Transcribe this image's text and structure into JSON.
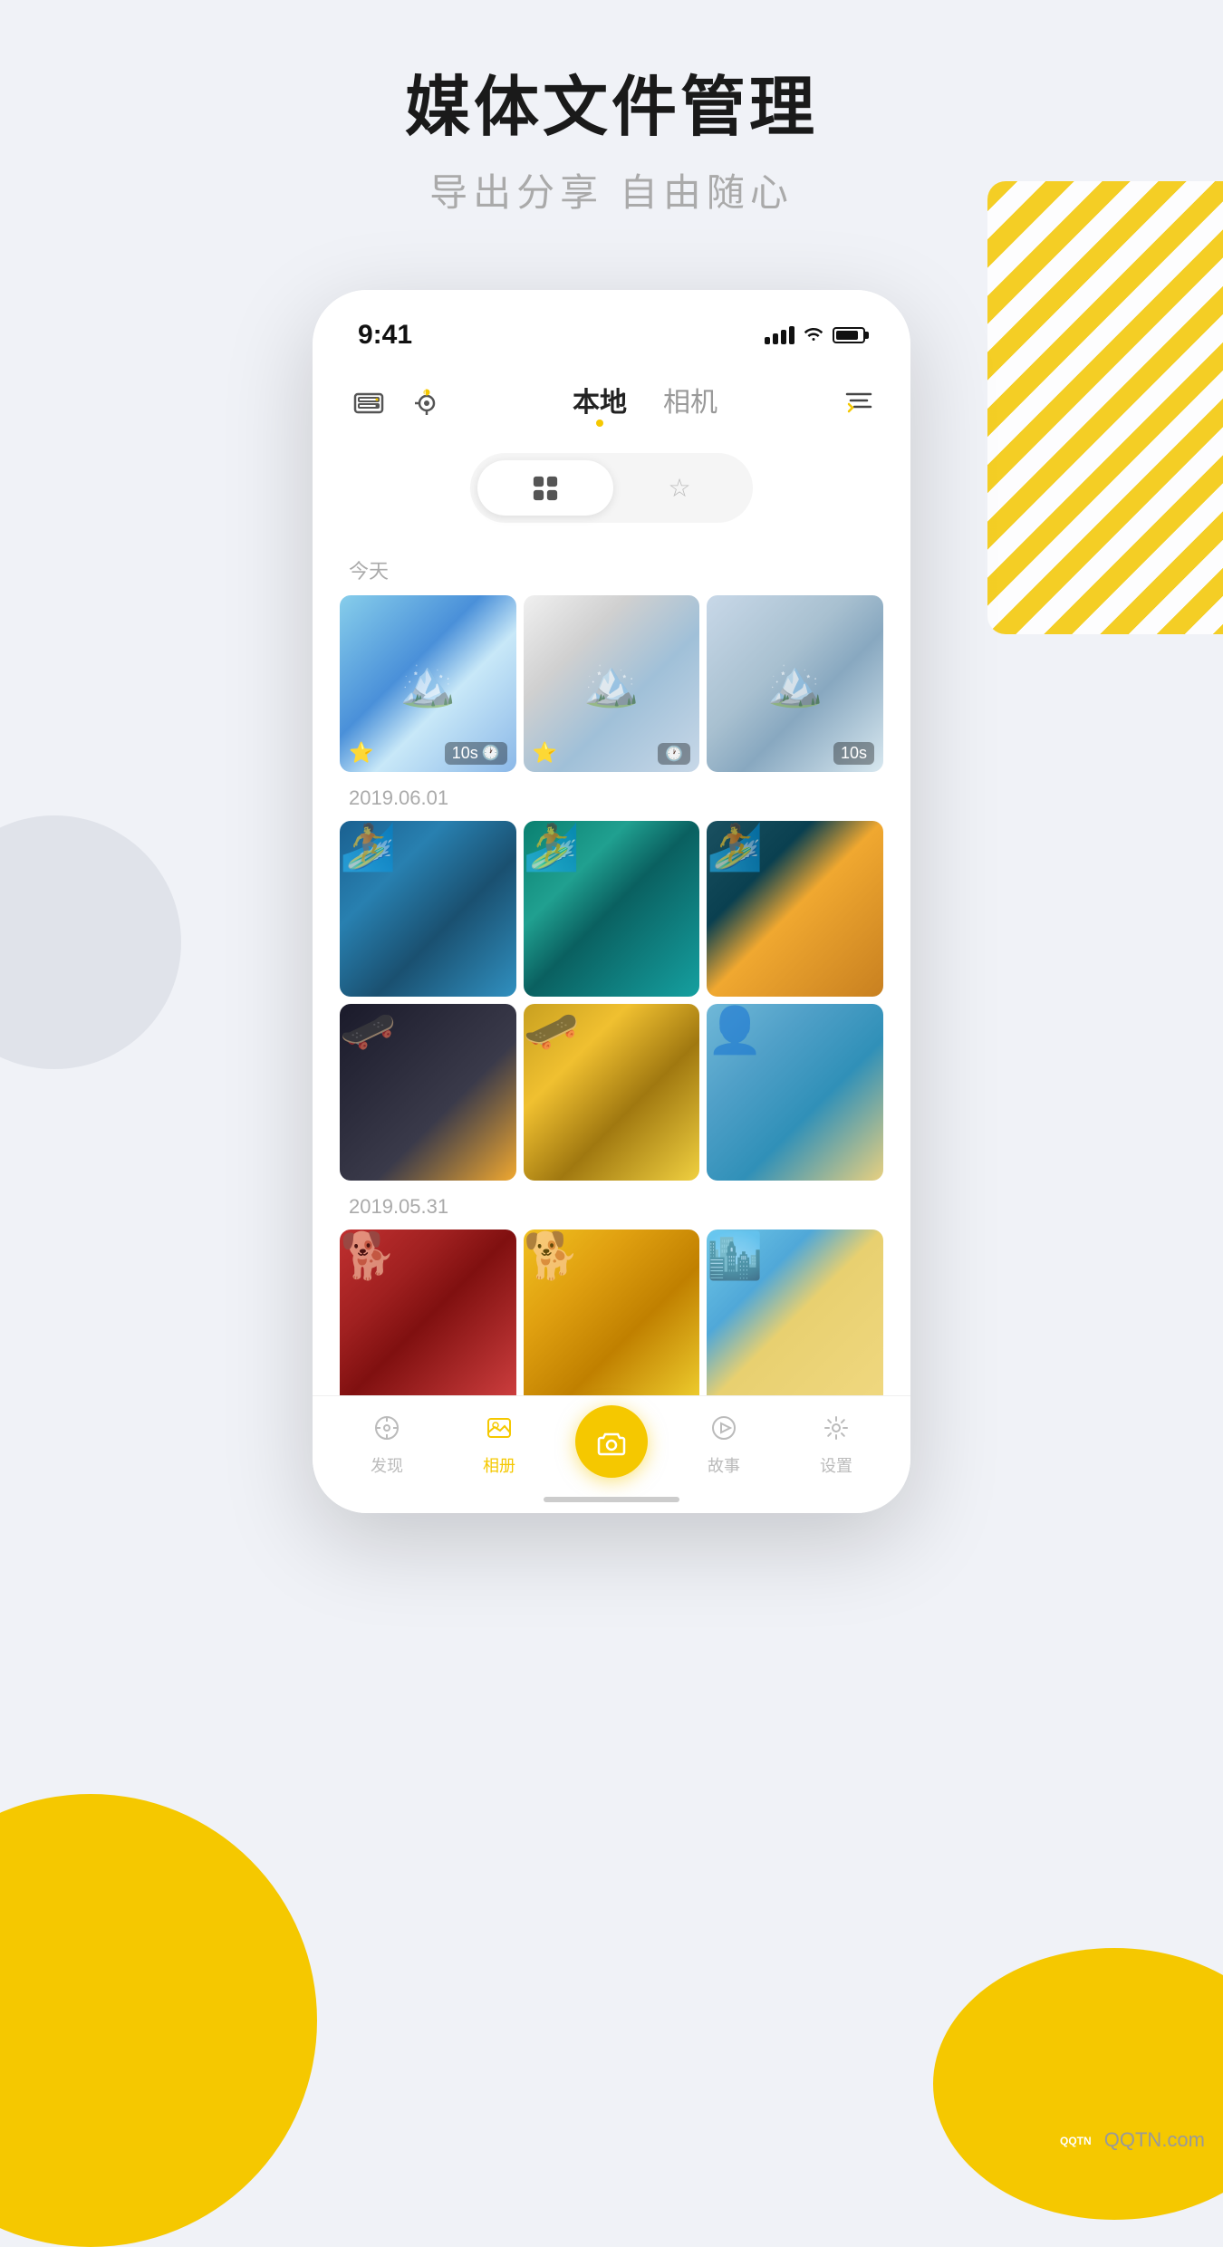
{
  "app": {
    "title": "媒体文件管理",
    "subtitle": "导出分享 自由随心"
  },
  "status_bar": {
    "time": "9:41"
  },
  "nav": {
    "tab_local": "本地",
    "tab_camera": "相机",
    "filter_label": "filter"
  },
  "filter_tabs": {
    "all_label": "all",
    "favorite_label": "favorite"
  },
  "sections": [
    {
      "date": "今天",
      "photos": [
        {
          "id": "p1",
          "duration": "10s",
          "starred": true,
          "has_clock": true
        },
        {
          "id": "p2",
          "duration": "",
          "starred": true,
          "has_clock": true
        },
        {
          "id": "p3",
          "duration": "10s",
          "starred": false,
          "has_clock": false
        }
      ]
    },
    {
      "date": "2019.06.01",
      "photos": [
        {
          "id": "p4",
          "duration": "",
          "starred": false,
          "has_clock": false
        },
        {
          "id": "p5",
          "duration": "",
          "starred": false,
          "has_clock": false
        },
        {
          "id": "p6",
          "duration": "",
          "starred": false,
          "has_clock": false
        },
        {
          "id": "p7",
          "duration": "",
          "starred": false,
          "has_clock": false
        },
        {
          "id": "p8",
          "duration": "",
          "starred": false,
          "has_clock": false
        },
        {
          "id": "p9",
          "duration": "",
          "starred": false,
          "has_clock": false
        }
      ]
    },
    {
      "date": "2019.05.31",
      "photos": [
        {
          "id": "p10",
          "duration": "",
          "starred": false,
          "has_clock": false
        },
        {
          "id": "p11",
          "duration": "",
          "starred": false,
          "has_clock": false
        },
        {
          "id": "p12",
          "duration": "",
          "starred": false,
          "has_clock": false
        }
      ]
    }
  ],
  "bottom_nav": {
    "items": [
      {
        "id": "discover",
        "label": "发现",
        "active": false
      },
      {
        "id": "album",
        "label": "相册",
        "active": true
      },
      {
        "id": "camera",
        "label": "",
        "active": false,
        "is_camera": true
      },
      {
        "id": "stories",
        "label": "故事",
        "active": false
      },
      {
        "id": "settings",
        "label": "设置",
        "active": false
      }
    ]
  },
  "watermark": {
    "text": "QQTN.com",
    "logo": "QQTN"
  },
  "colors": {
    "accent": "#f5c800",
    "active": "#f5c800",
    "inactive": "#bbbbbb",
    "text_primary": "#1a1a1a",
    "text_secondary": "#aaaaaa"
  }
}
